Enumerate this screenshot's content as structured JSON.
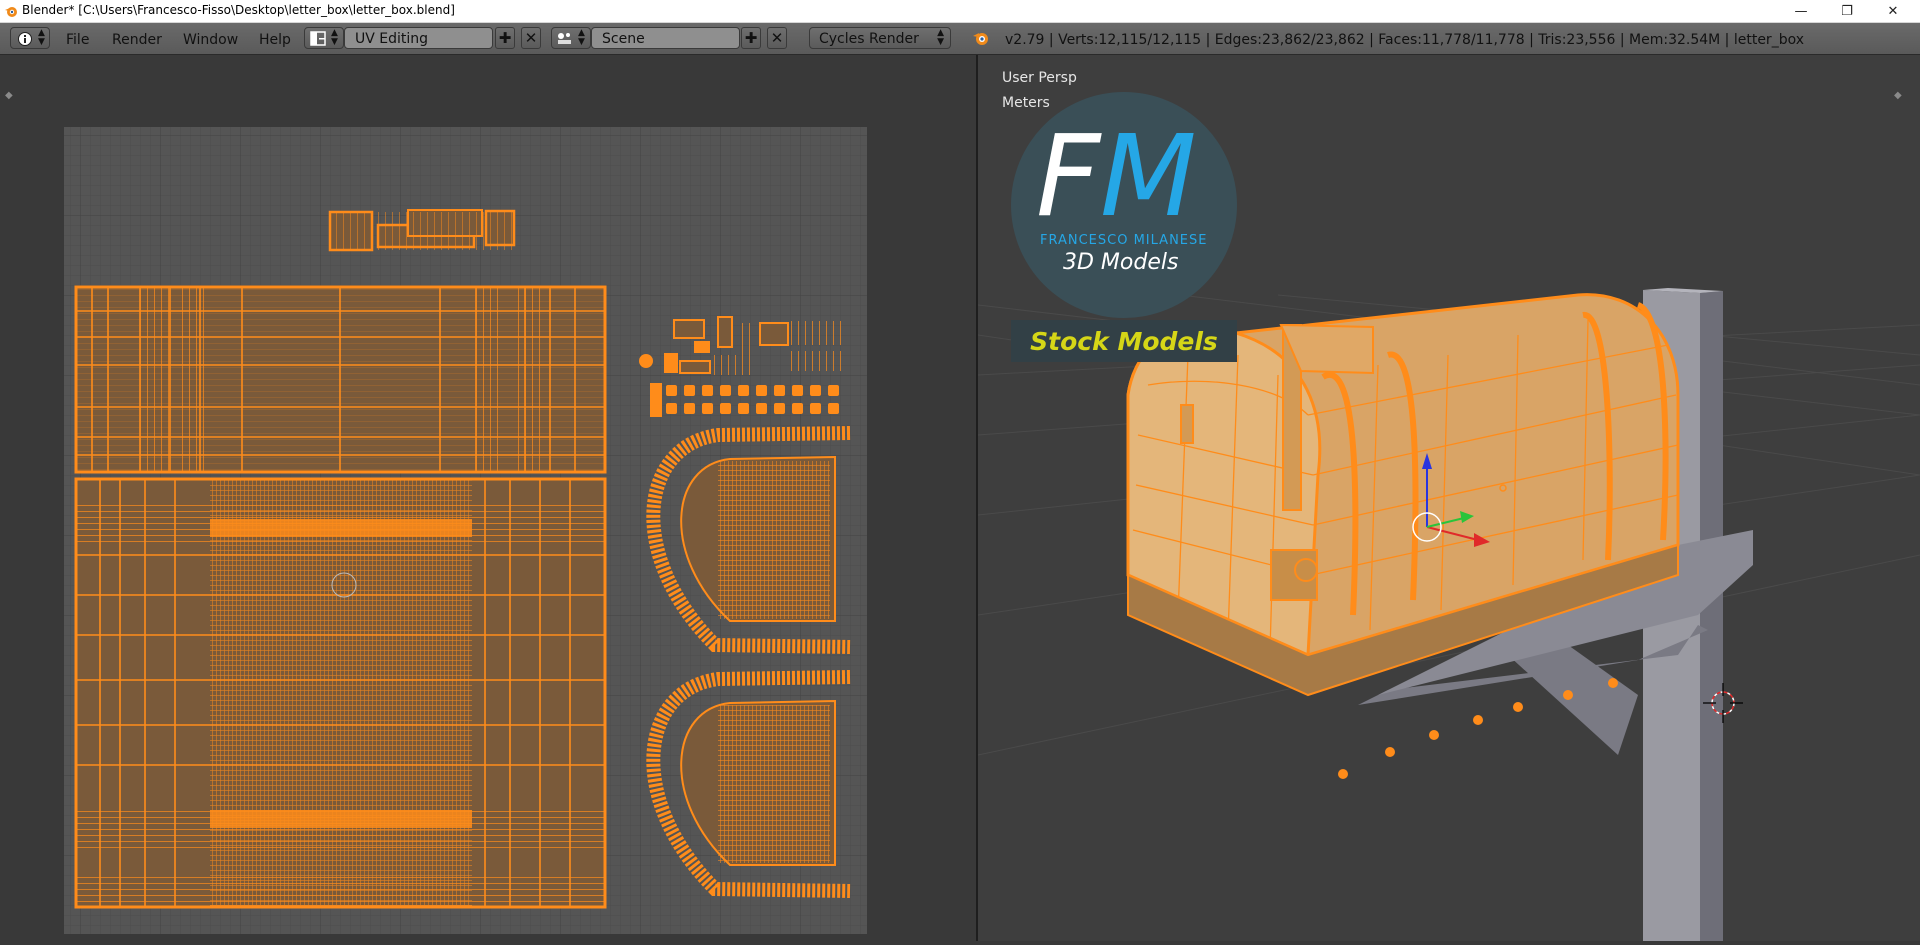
{
  "titlebar": {
    "title": "Blender* [C:\\Users\\Francesco-Fisso\\Desktop\\letter_box\\letter_box.blend]",
    "minimize": "—",
    "restore": "❐",
    "close": "✕"
  },
  "menubar": {
    "file": "File",
    "render": "Render",
    "window": "Window",
    "help": "Help"
  },
  "screen_layout": {
    "value": "UV Editing"
  },
  "scene": {
    "value": "Scene"
  },
  "render_engine": {
    "value": "Cycles Render"
  },
  "stats": "v2.79 | Verts:12,115/12,115 | Edges:23,862/23,862 | Faces:11,778/11,778 | Tris:23,556 | Mem:32.54M | letter_box",
  "viewport": {
    "view_label": "User Persp",
    "units_label": "Meters"
  },
  "logo": {
    "initials": "FM",
    "initial_f": "F",
    "initial_m": "M",
    "name": "FRANCESCO MILANESE",
    "tagline": "3D Models",
    "banner": "Stock Models"
  },
  "colors": {
    "accent_orange": "#ff8c1a",
    "header_bg": "#5f5f5f",
    "uv_grid_bg": "#555555",
    "viewport_bg": "#3e3e3e",
    "logo_blue": "#25a7e6",
    "banner_yellow": "#d6d617"
  }
}
